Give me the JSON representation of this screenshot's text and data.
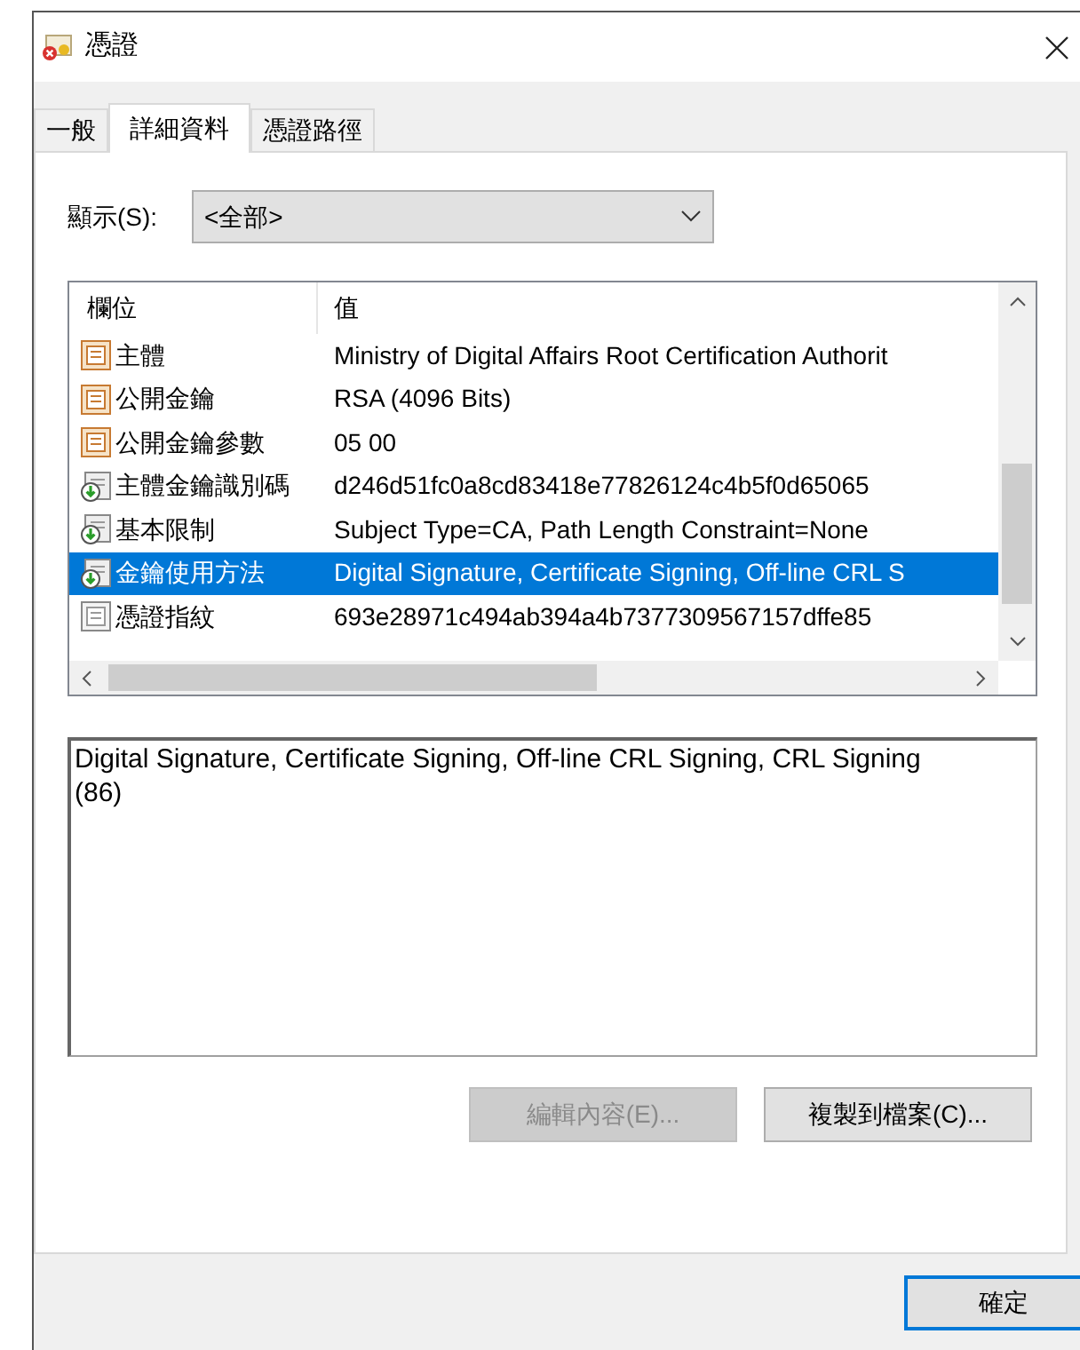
{
  "window": {
    "title": "憑證"
  },
  "tabs": [
    {
      "label": "一般",
      "selected": false
    },
    {
      "label": "詳細資料",
      "selected": true
    },
    {
      "label": "憑證路徑",
      "selected": false
    }
  ],
  "show": {
    "label": "顯示(S):",
    "value": "<全部>"
  },
  "table": {
    "columns": [
      "欄位",
      "值"
    ],
    "rows": [
      {
        "kind": "property",
        "field": "主體",
        "value": "Ministry of Digital Affairs Root Certification Authorit",
        "selected": false
      },
      {
        "kind": "property",
        "field": "公開金鑰",
        "value": "RSA (4096 Bits)",
        "selected": false
      },
      {
        "kind": "property",
        "field": "公開金鑰參數",
        "value": "05 00",
        "selected": false
      },
      {
        "kind": "extension",
        "field": "主體金鑰識別碼",
        "value": "d246d51fc0a8cd83418e77826124c4b5f0d65065",
        "selected": false
      },
      {
        "kind": "extension",
        "field": "基本限制",
        "value": "Subject Type=CA, Path Length Constraint=None",
        "selected": false
      },
      {
        "kind": "extension",
        "field": "金鑰使用方法",
        "value": "Digital Signature, Certificate Signing, Off-line CRL S",
        "selected": true
      },
      {
        "kind": "thumbprint",
        "field": "憑證指紋",
        "value": "693e28971c494ab394a4b7377309567157dffe85",
        "selected": false
      }
    ]
  },
  "detail": {
    "value": "Digital Signature, Certificate Signing, Off-line CRL Signing, CRL Signing\n(86)"
  },
  "buttons": [
    {
      "label": "編輯內容(E)...",
      "disabled": true
    },
    {
      "label": "複製到檔案(C)...",
      "disabled": false
    }
  ],
  "ok_button": {
    "label": "確定"
  }
}
